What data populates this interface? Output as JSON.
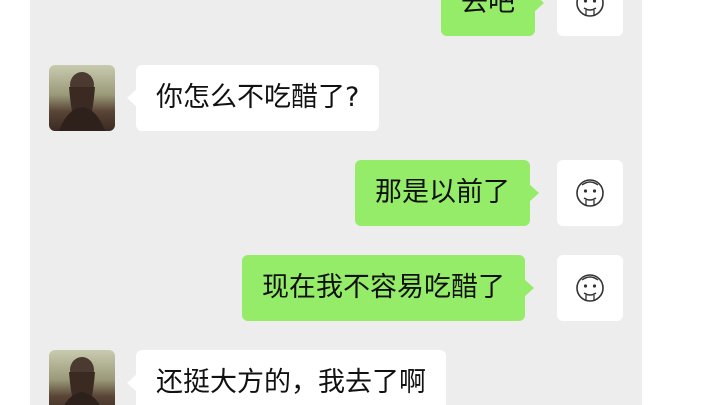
{
  "messages": [
    {
      "sender": "me",
      "text": "去吧",
      "avatar_icon": "doodle-face-icon"
    },
    {
      "sender": "her",
      "text": "你怎么不吃醋了?",
      "avatar_icon": "girl-photo-avatar"
    },
    {
      "sender": "me",
      "text": "那是以前了",
      "avatar_icon": "doodle-face-icon"
    },
    {
      "sender": "me",
      "text": "现在我不容易吃醋了",
      "avatar_icon": "doodle-face-icon"
    },
    {
      "sender": "her",
      "text": "还挺大方的，我去了啊",
      "avatar_icon": "girl-photo-avatar"
    }
  ],
  "colors": {
    "chat_background": "#ededed",
    "outgoing_bubble": "#95ec69",
    "incoming_bubble": "#ffffff"
  }
}
